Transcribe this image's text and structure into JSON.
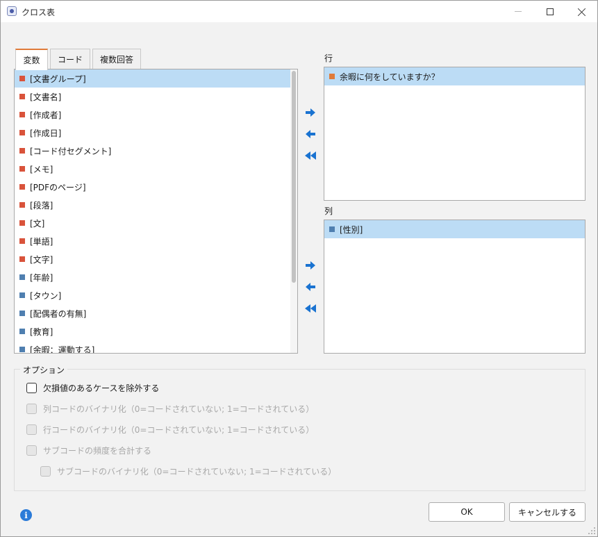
{
  "window": {
    "title": "クロス表"
  },
  "tabs": [
    {
      "label": "変数"
    },
    {
      "label": "コード"
    },
    {
      "label": "複数回答"
    }
  ],
  "variables": [
    {
      "label": "[文書グループ]",
      "color": "#d9533b"
    },
    {
      "label": "[文書名]",
      "color": "#d9533b"
    },
    {
      "label": "[作成者]",
      "color": "#d9533b"
    },
    {
      "label": "[作成日]",
      "color": "#d9533b"
    },
    {
      "label": "[コード付セグメント]",
      "color": "#d9533b"
    },
    {
      "label": "[メモ]",
      "color": "#d9533b"
    },
    {
      "label": "[PDFのページ]",
      "color": "#d9533b"
    },
    {
      "label": "[段落]",
      "color": "#d9533b"
    },
    {
      "label": "[文]",
      "color": "#d9533b"
    },
    {
      "label": "[単語]",
      "color": "#d9533b"
    },
    {
      "label": "[文字]",
      "color": "#d9533b"
    },
    {
      "label": "[年齢]",
      "color": "#4f7fb0"
    },
    {
      "label": "[タウン]",
      "color": "#4f7fb0"
    },
    {
      "label": "[配偶者の有無]",
      "color": "#4f7fb0"
    },
    {
      "label": "[教育]",
      "color": "#4f7fb0"
    },
    {
      "label": "[余暇：運動する]",
      "color": "#4f7fb0"
    }
  ],
  "rows": {
    "label": "行",
    "items": [
      {
        "label": "余暇に何をしていますか？",
        "color": "#e07b39"
      }
    ]
  },
  "columns": {
    "label": "列",
    "items": [
      {
        "label": "[性別]",
        "color": "#4f7fb0"
      }
    ]
  },
  "options": {
    "legend": "オプション",
    "exclude_missing": {
      "label": "欠損値のあるケースを除外する",
      "checked": false,
      "enabled": true
    },
    "binarize_col": {
      "label": "列コードのバイナリ化（0=コードされていない; 1=コードされている）",
      "checked": false,
      "enabled": false
    },
    "binarize_row": {
      "label": "行コードのバイナリ化（0=コードされていない; 1=コードされている）",
      "checked": false,
      "enabled": false
    },
    "sum_subcodes": {
      "label": "サブコードの頻度を合計する",
      "checked": false,
      "enabled": false
    },
    "binarize_subcodes": {
      "label": "サブコードのバイナリ化（0=コードされていない; 1=コードされている）",
      "checked": false,
      "enabled": false
    }
  },
  "buttons": {
    "ok": "OK",
    "cancel": "キャンセルする"
  },
  "icons": {
    "arrow_color": "#1a73d1",
    "info": "i"
  }
}
